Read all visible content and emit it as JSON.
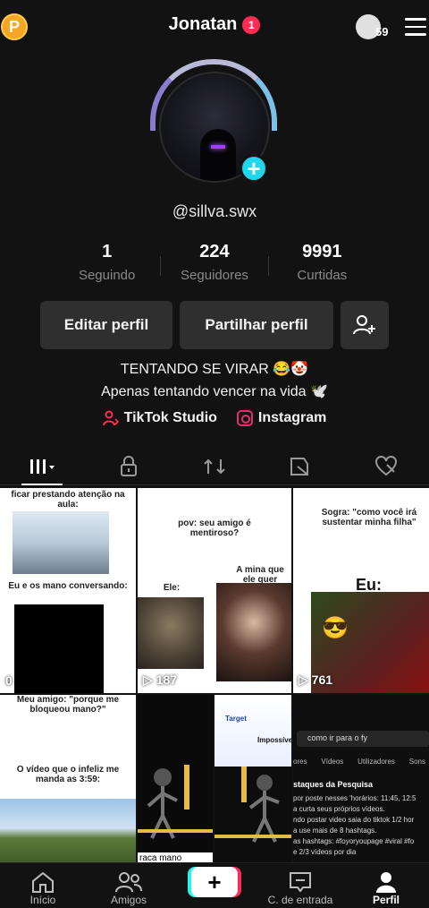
{
  "header": {
    "coin_label": "P",
    "username": "Jonatan",
    "notification_count": "1",
    "streak_count": "59"
  },
  "profile": {
    "handle": "@sillva.swx",
    "stats": [
      {
        "value": "1",
        "label": "Seguindo"
      },
      {
        "value": "224",
        "label": "Seguidores"
      },
      {
        "value": "9991",
        "label": "Curtidas"
      }
    ],
    "buttons": {
      "edit": "Editar perfil",
      "share": "Partilhar perfil"
    },
    "bio_line1": "TENTANDO SE VIRAR 😂🤡",
    "bio_line2": "Apenas tentando vencer na vida 🕊️",
    "links": {
      "studio": "TikTok Studio",
      "instagram": "Instagram"
    }
  },
  "grid": {
    "cells": [
      {
        "caption_top": "ficar prestando atenção na aula:",
        "caption_mid": "Eu e os mano conversando:",
        "views": "0"
      },
      {
        "caption_top": "pov: seu amigo é mentiroso?",
        "caption_mid": "Ele:",
        "caption_right": "A mina que ele quer pegar:",
        "views": "187"
      },
      {
        "caption_top": "Sogra: \"como você irá sustentar minha filha\"",
        "caption_mid": "Eu:",
        "views": "761"
      },
      {
        "caption_top": "Meu amigo: \"porque me bloqueou mano?\"",
        "caption_mid": "O vídeo que o infeliz me manda as 3:59:"
      },
      {
        "caption_bottom": "raca mano"
      },
      {
        "caption_top": "Target",
        "caption_mid": "Impossível"
      },
      {
        "search_text": "como ir para o fy",
        "search_tabs": [
          "ores",
          "Vídeos",
          "Utilizadores",
          "Sons"
        ],
        "heading": "staques da Pesquisa",
        "lines": [
          "por poste nesses 'horários: 11:45, 12:5",
          "a curta seus próprios vídeos.",
          "ndo postar video saia do tiktok 1/2 hor",
          "a use mais de 8 hashtags.",
          "as hashtags: #foyoryoupage #viral #fo",
          "e 2/3 vídeos por dia"
        ]
      }
    ]
  },
  "bottom_nav": {
    "home": "Início",
    "friends": "Amigos",
    "inbox": "C. de entrada",
    "profile": "Perfil"
  },
  "colors": {
    "accent_pink": "#fe2c55",
    "accent_cyan": "#25f4ee",
    "background": "#121212"
  }
}
